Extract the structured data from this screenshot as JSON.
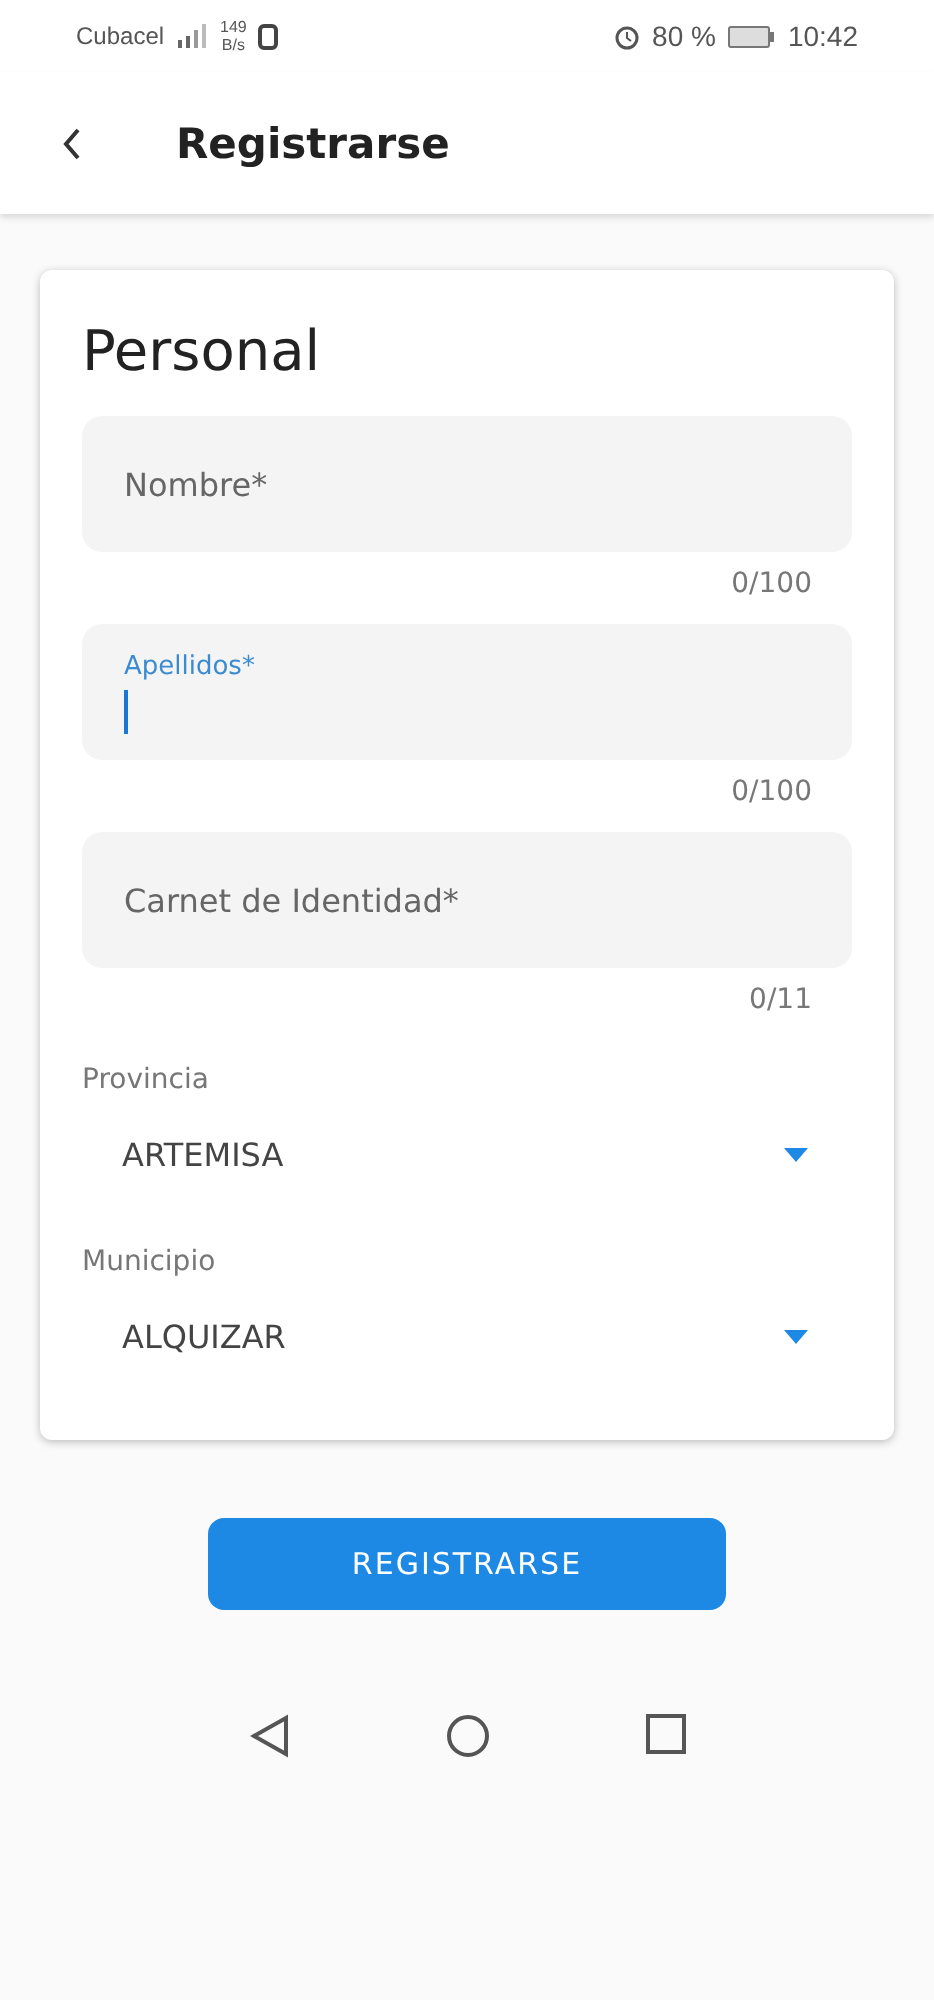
{
  "status_bar": {
    "carrier": "Cubacel",
    "speed_value": "149",
    "speed_unit": "B/s",
    "battery": "80 %",
    "time": "10:42"
  },
  "app_bar": {
    "title": "Registrarse"
  },
  "section": {
    "title": "Personal",
    "fields": [
      {
        "label": "Nombre*",
        "counter": "0/100",
        "focused": false
      },
      {
        "label": "Apellidos*",
        "counter": "0/100",
        "focused": true
      },
      {
        "label": "Carnet de Identidad*",
        "counter": "0/11",
        "focused": false
      }
    ],
    "selects": [
      {
        "label": "Provincia",
        "value": "ARTEMISA"
      },
      {
        "label": "Municipio",
        "value": "ALQUIZAR"
      }
    ]
  },
  "submit_button": "REGISTRARSE"
}
